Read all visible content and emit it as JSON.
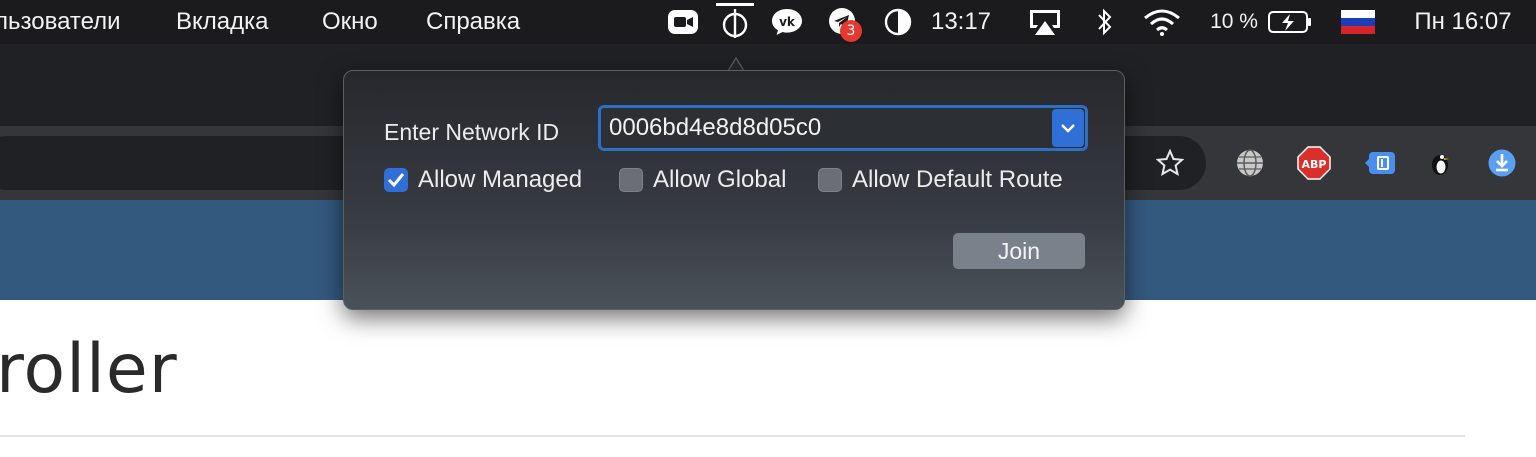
{
  "menubar": {
    "menus": [
      "льзователи",
      "Вкладка",
      "Окно",
      "Справка"
    ],
    "clock_extra": "13:17",
    "battery": "10 %",
    "datetime": "Пн 16:07",
    "telegram_badge": "3"
  },
  "extensions": {
    "abp_label": "ABP"
  },
  "page": {
    "title_fragment": "roller"
  },
  "popover": {
    "network_id_label": "Enter Network ID",
    "network_id_value": "0006bd4e8d8d05c0",
    "checkboxes": [
      {
        "label": "Allow Managed",
        "checked": true
      },
      {
        "label": "Allow Global",
        "checked": false
      },
      {
        "label": "Allow Default Route",
        "checked": false
      }
    ],
    "join_label": "Join"
  },
  "colors": {
    "accent": "#2f6fd6",
    "navband": "#34597f",
    "menubar": "#1b1b1d"
  }
}
